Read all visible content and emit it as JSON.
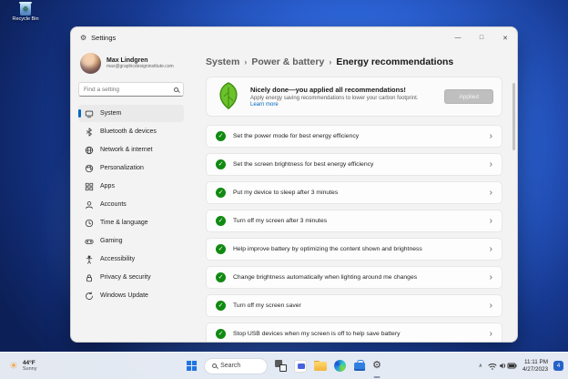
{
  "desktop": {
    "recycle_bin_label": "Recycle Bin"
  },
  "colors": {
    "accent": "#0067c0",
    "success_green": "#118a11",
    "leaf_green": "#61b51f"
  },
  "icons": {
    "settings_gear": "⚙",
    "check": "✓",
    "chevron_right": "›",
    "breadcrumb_sep": "›",
    "minimize": "—",
    "maximize": "□",
    "close": "✕",
    "tray_chevron": "∧",
    "sun": "☀"
  },
  "settings_window": {
    "title": "Settings",
    "user": {
      "name": "Max Lindgren",
      "email": "max@graphicdesigninstitute.com"
    },
    "search_placeholder": "Find a setting",
    "nav": [
      {
        "label": "System",
        "selected": true
      },
      {
        "label": "Bluetooth & devices",
        "selected": false
      },
      {
        "label": "Network & internet",
        "selected": false
      },
      {
        "label": "Personalization",
        "selected": false
      },
      {
        "label": "Apps",
        "selected": false
      },
      {
        "label": "Accounts",
        "selected": false
      },
      {
        "label": "Time & language",
        "selected": false
      },
      {
        "label": "Gaming",
        "selected": false
      },
      {
        "label": "Accessibility",
        "selected": false
      },
      {
        "label": "Privacy & security",
        "selected": false
      },
      {
        "label": "Windows Update",
        "selected": false
      }
    ],
    "breadcrumb": {
      "items": [
        "System",
        "Power & battery",
        "Energy recommendations"
      ]
    },
    "banner": {
      "title": "Nicely done—you applied all recommendations!",
      "subtitle": "Apply energy saving recommendations to lower your carbon footprint.",
      "link_label": "Learn more",
      "button_label": "Applied"
    },
    "recommendations": [
      "Set the power mode for best energy efficiency",
      "Set the screen brightness for best energy efficiency",
      "Put my device to sleep after 3 minutes",
      "Turn off my screen after 3 minutes",
      "Help improve battery by optimizing the content shown and brightness",
      "Change brightness automatically when lighting around me changes",
      "Turn off my screen saver",
      "Stop USB devices when my screen is off to help save battery"
    ]
  },
  "taskbar": {
    "weather": {
      "temp": "44°F",
      "condition": "Sunny"
    },
    "search_label": "Search",
    "tray": {
      "time": "11:11 PM",
      "date": "4/27/2023",
      "badge": "4"
    }
  }
}
